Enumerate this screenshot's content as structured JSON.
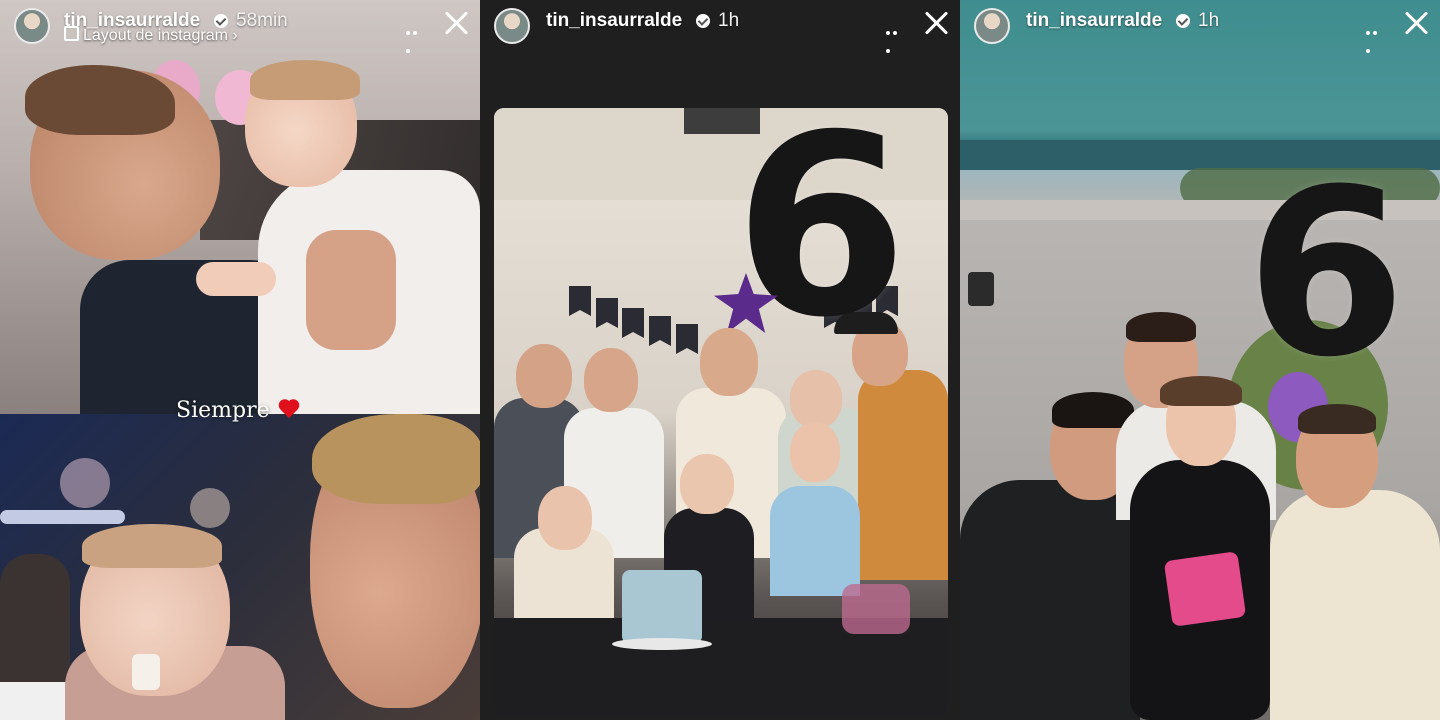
{
  "stories": [
    {
      "username": "tin_insaurralde",
      "time": "58min",
      "subtitle": "Layout de instagram ›",
      "caption": "Siempre"
    },
    {
      "username": "tin_insaurralde",
      "time": "1h",
      "balloon_number": "6"
    },
    {
      "username": "tin_insaurralde",
      "time": "1h",
      "balloon_number": "6"
    }
  ],
  "icons": [
    "verified-badge-icon",
    "more-options-icon",
    "close-icon",
    "layout-icon",
    "heart-icon"
  ],
  "colors": {
    "heart": "#e0111d",
    "header_text": "#ffffff"
  }
}
